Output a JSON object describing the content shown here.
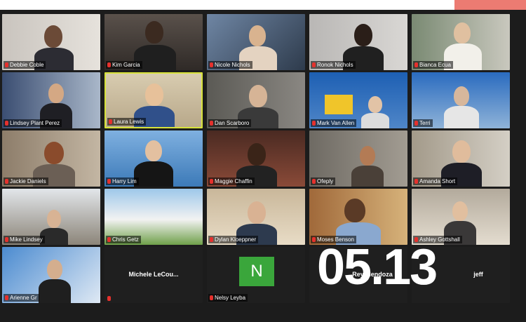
{
  "date_label": "05.13",
  "colors": {
    "accent": "#ec7b72",
    "speaker_border": "#d7e23a",
    "avatar_n": "#3aa63b",
    "mic_muted": "#e5312d"
  },
  "participants": [
    {
      "name": "Debbie Coble"
    },
    {
      "name": "Kim Garcia"
    },
    {
      "name": "Nicole Nichols"
    },
    {
      "name": "Ronok Nichols"
    },
    {
      "name": "Bianca Ecua"
    },
    {
      "name": "Lindsey Plant Perez"
    },
    {
      "name": "Laura Lewis"
    },
    {
      "name": "Dan Scarboro"
    },
    {
      "name": "Mark Van Allen"
    },
    {
      "name": "Terri"
    },
    {
      "name": "Jackie Daniels"
    },
    {
      "name": "Harry Lim"
    },
    {
      "name": "Maggie Chaffin"
    },
    {
      "name": "Ofeply"
    },
    {
      "name": "Amanda Short"
    },
    {
      "name": "Mike Lindsey"
    },
    {
      "name": "Chris Getz"
    },
    {
      "name": "Dylan Kloeppner"
    },
    {
      "name": "Moses Benson"
    },
    {
      "name": "Ashley Gottshall"
    },
    {
      "name": "Arienne Gr"
    },
    {
      "name": "Michele LeCou..."
    },
    {
      "name": "Nelsy Leyba",
      "avatar_letter": "N"
    },
    {
      "name": "Rey Mendoza"
    },
    {
      "name": "jeff"
    }
  ]
}
